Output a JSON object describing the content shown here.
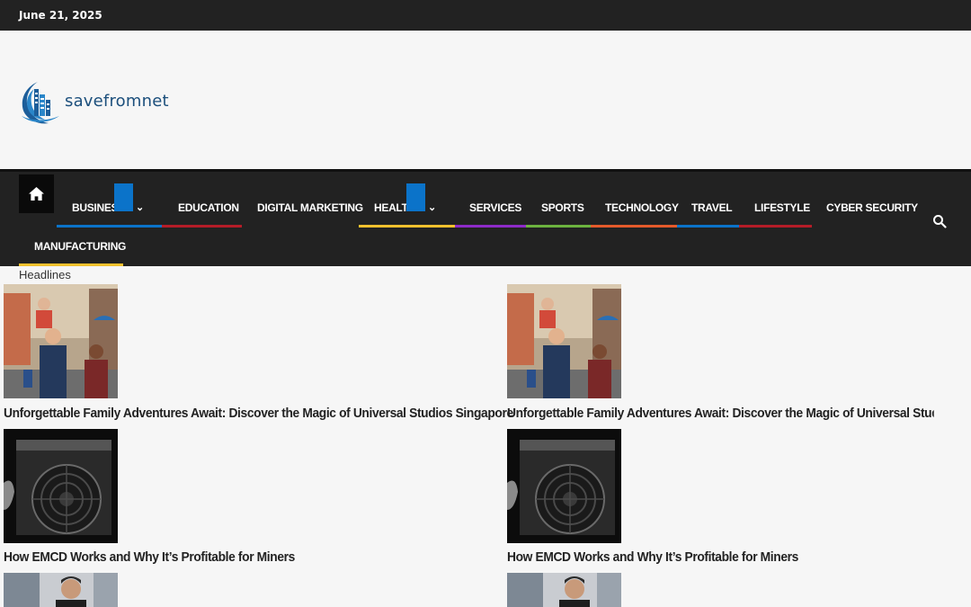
{
  "topbar": {
    "date": "June 21, 2025"
  },
  "brand": {
    "name": "savefromnet",
    "logo_icon": "building-arc-logo-icon",
    "color": "#1c4f7c"
  },
  "nav": {
    "home_icon": "home-icon",
    "search_icon": "search-icon",
    "items": [
      {
        "label": "BUSINESS",
        "has_dropdown": true,
        "underline": "#0b73c9"
      },
      {
        "label": "EDUCATION",
        "has_dropdown": false,
        "underline": "#b51c28"
      },
      {
        "label": "DIGITAL MARKETING",
        "has_dropdown": false,
        "underline": "#222222"
      },
      {
        "label": "HEALTH",
        "has_dropdown": true,
        "underline": "#f2c12e"
      },
      {
        "label": "SERVICES",
        "has_dropdown": false,
        "underline": "#8e2bc9"
      },
      {
        "label": "SPORTS",
        "has_dropdown": false,
        "underline": "#6cb33f"
      },
      {
        "label": "TECHNOLOGY",
        "has_dropdown": false,
        "underline": "#e55a2b"
      },
      {
        "label": "TRAVEL",
        "has_dropdown": false,
        "underline": "#0b73c9"
      },
      {
        "label": "LIFESTYLE",
        "has_dropdown": false,
        "underline": "#b51c28"
      },
      {
        "label": "CYBER SECURITY",
        "has_dropdown": false,
        "underline": "#222222"
      },
      {
        "label": "MANUFACTURING",
        "has_dropdown": false,
        "underline": "#f2c12e"
      }
    ]
  },
  "headlines": {
    "label": "Headlines",
    "posts": [
      {
        "title": "Unforgettable Family Adventures Await: Discover the Magic of Universal Studios Singapore",
        "image": "family-universal-studios-image"
      },
      {
        "title": "Unforgettable Family Adventures Await: Discover the Magic of Universal Studios Singapore",
        "image": "family-universal-studios-image"
      },
      {
        "title": "How EMCD Works and Why It’s Profitable for Miners",
        "image": "crypto-miner-fan-image"
      },
      {
        "title": "How EMCD Works and Why It’s Profitable for Miners",
        "image": "crypto-miner-fan-image"
      },
      {
        "title": "",
        "image": "man-in-suit-image"
      },
      {
        "title": "",
        "image": "man-in-suit-image"
      }
    ]
  }
}
